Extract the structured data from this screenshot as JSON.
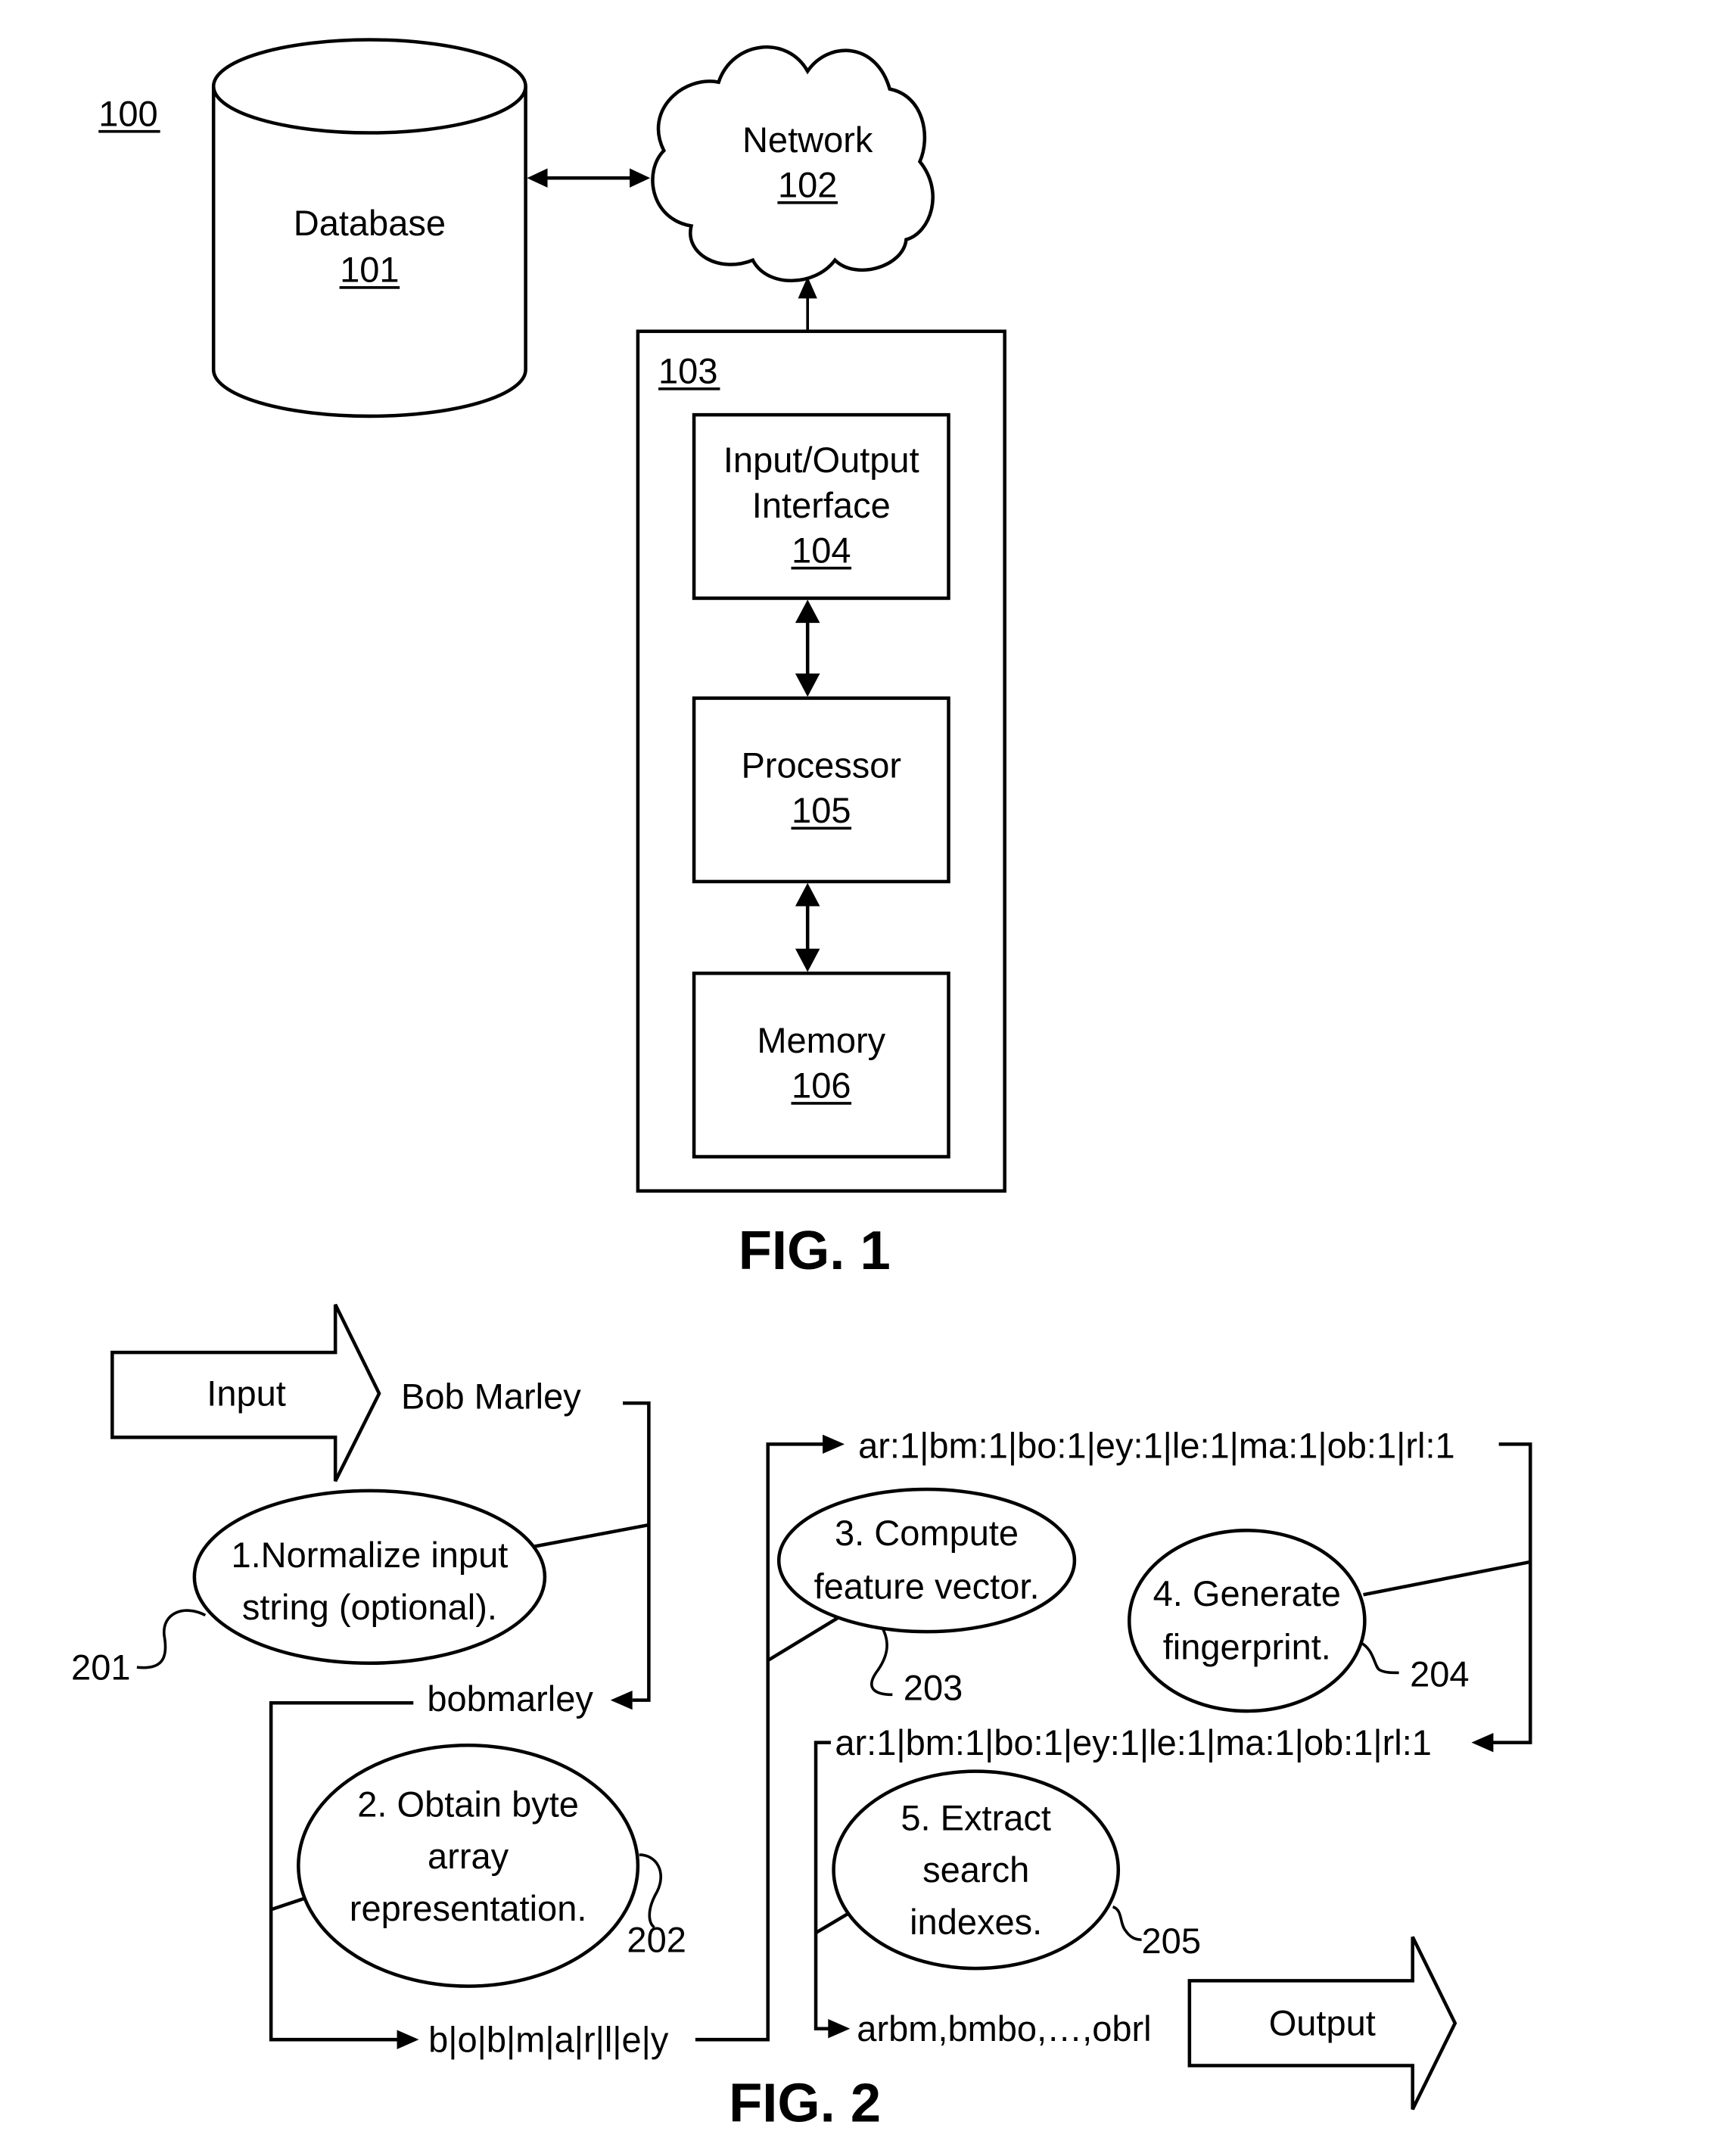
{
  "fig1": {
    "system_ref": "100",
    "database": {
      "label": "Database",
      "ref": "101"
    },
    "network": {
      "label": "Network",
      "ref": "102"
    },
    "device_ref": "103",
    "io_interface": {
      "label_line1": "Input/Output",
      "label_line2": "Interface",
      "ref": "104"
    },
    "processor": {
      "label": "Processor",
      "ref": "105"
    },
    "memory": {
      "label": "Memory",
      "ref": "106"
    },
    "caption": "FIG. 1"
  },
  "fig2": {
    "input_arrow_label": "Input",
    "input_value": "Bob Marley",
    "step1": {
      "line1": "1.Normalize input",
      "line2": "string (optional).",
      "ref": "201"
    },
    "normalized_value": "bobmarley",
    "step2": {
      "line1": "2. Obtain byte",
      "line2": "array",
      "line3": "representation.",
      "ref": "202"
    },
    "byte_array_value": "b|o|b|m|a|r|l|e|y",
    "step3": {
      "line1": "3. Compute",
      "line2": "feature vector.",
      "ref": "203"
    },
    "feature_vector_value": "ar:1|bm:1|bo:1|ey:1|le:1|ma:1|ob:1|rl:1",
    "step4": {
      "line1": "4. Generate",
      "line2": "fingerprint.",
      "ref": "204"
    },
    "fingerprint_value": "ar:1|bm:1|bo:1|ey:1|le:1|ma:1|ob:1|rl:1",
    "step5": {
      "line1": "5. Extract",
      "line2": "search",
      "line3": "indexes.",
      "ref": "205"
    },
    "indexes_value": "arbm,bmbo,…,obrl",
    "output_arrow_label": "Output",
    "caption": "FIG. 2"
  }
}
